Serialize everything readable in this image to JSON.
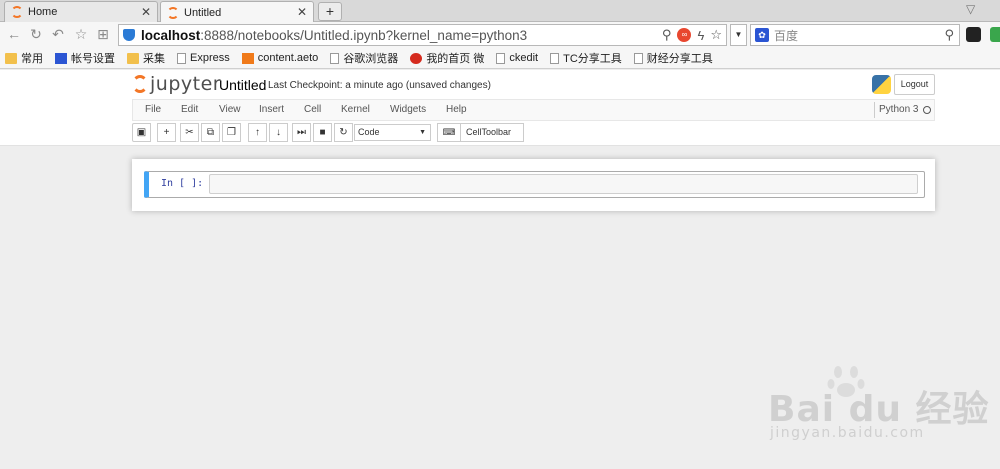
{
  "browser": {
    "tabs": [
      {
        "title": "Home",
        "active": false
      },
      {
        "title": "Untitled",
        "active": true
      }
    ],
    "new_tab": "+",
    "address": {
      "host": "localhost",
      "rest": ":8888/notebooks/Untitled.ipynb?kernel_name=python3"
    },
    "search_placeholder": "百度",
    "bookmarks": [
      {
        "label": "常用",
        "icon": "folder"
      },
      {
        "label": "帐号设置",
        "icon": "blue"
      },
      {
        "label": "采集",
        "icon": "folder"
      },
      {
        "label": "Express",
        "icon": "page"
      },
      {
        "label": "content.aeto",
        "icon": "orange"
      },
      {
        "label": "谷歌浏览器",
        "icon": "page"
      },
      {
        "label": "我的首页 微",
        "icon": "red"
      },
      {
        "label": "ckedit",
        "icon": "page"
      },
      {
        "label": "TC分享工具",
        "icon": "page"
      },
      {
        "label": "财经分享工具",
        "icon": "page"
      }
    ]
  },
  "jupyter": {
    "wordmark": "jupyter",
    "notebook_name": "Untitled",
    "checkpoint": "Last Checkpoint: a minute ago (unsaved changes)",
    "logout": "Logout",
    "menu": [
      "File",
      "Edit",
      "View",
      "Insert",
      "Cell",
      "Kernel",
      "Widgets",
      "Help"
    ],
    "kernel_name": "Python 3",
    "cell_type": "Code",
    "celltoolbar": "CellToolbar",
    "cell_prompt": "In [ ]:"
  },
  "watermark": {
    "brand": "Bai du 经验",
    "url": "jingyan.baidu.com"
  }
}
